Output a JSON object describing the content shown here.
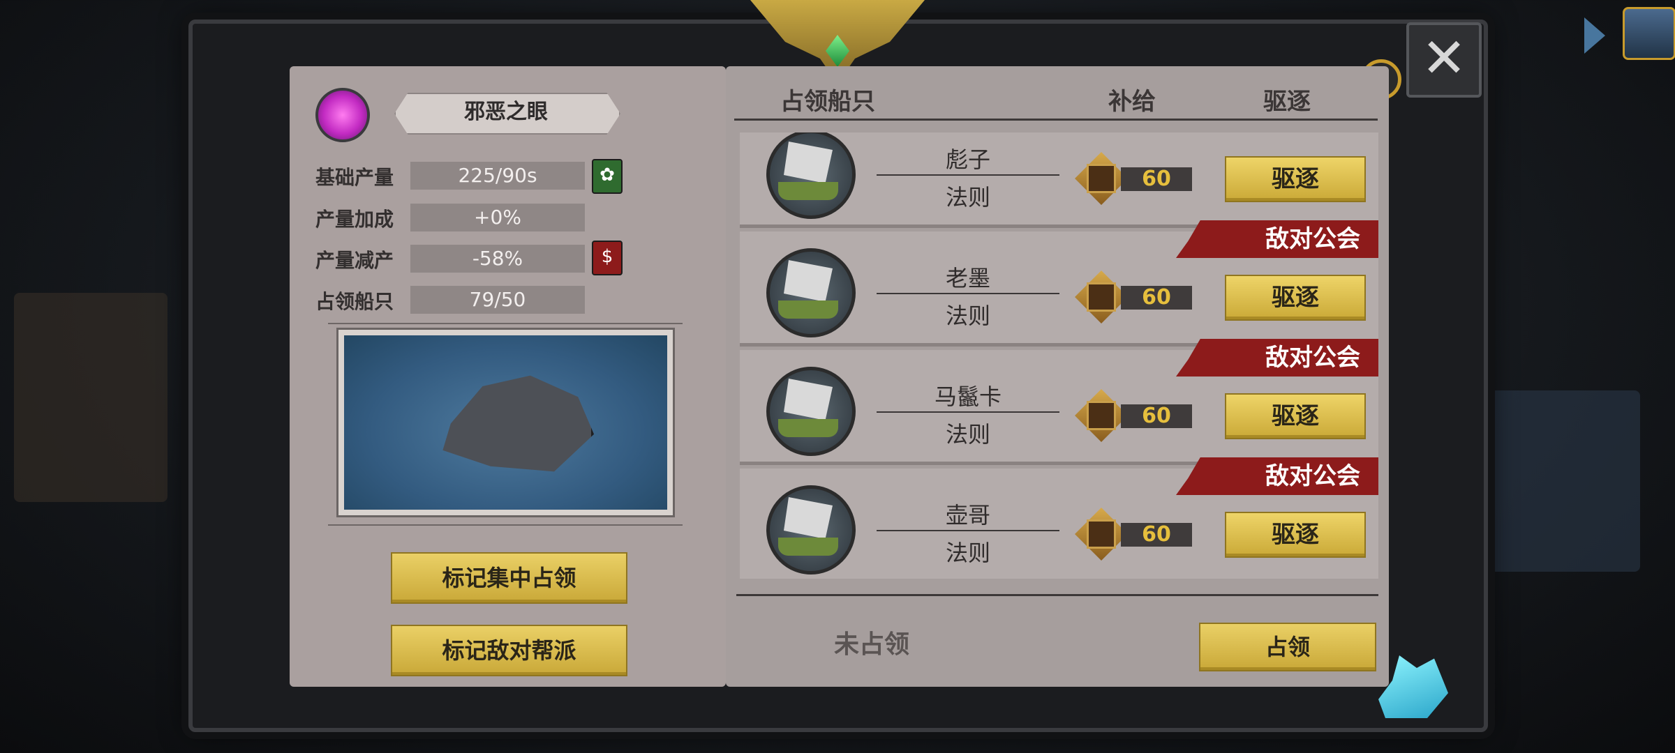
{
  "colors": {
    "accent_gold": "#e6c24f",
    "hostile_red": "#8d1b1b",
    "page_bg": "#aaa09f",
    "supply_text": "#e6bf3d"
  },
  "close_icon": "✕",
  "help_icon": "!",
  "territory": {
    "name": "邪恶之眼",
    "stats": [
      {
        "label": "基础产量",
        "value": "225/90s",
        "icon": "resource-icon"
      },
      {
        "label": "产量加成",
        "value": "+0%"
      },
      {
        "label": "产量减产",
        "value": "-58%",
        "icon": "penalty-icon"
      },
      {
        "label": "占领船只",
        "value": "79/50"
      }
    ],
    "buttons": {
      "mark_focus": "标记集中占领",
      "mark_hostile": "标记敌对帮派"
    }
  },
  "table": {
    "headers": {
      "ships": "占领船只",
      "supply": "补给",
      "expel": "驱逐"
    },
    "rows": [
      {
        "player": "彪子",
        "guild": "法则",
        "supply": "60",
        "hostile": "",
        "action": "驱逐"
      },
      {
        "player": "老墨",
        "guild": "法则",
        "supply": "60",
        "hostile": "敌对公会",
        "action": "驱逐"
      },
      {
        "player": "马鬣卡",
        "guild": "法则",
        "supply": "60",
        "hostile": "敌对公会",
        "action": "驱逐"
      },
      {
        "player": "壶哥",
        "guild": "法则",
        "supply": "60",
        "hostile": "敌对公会",
        "action": "驱逐"
      }
    ]
  },
  "footer": {
    "status": "未占领",
    "occupy_label": "占领"
  }
}
